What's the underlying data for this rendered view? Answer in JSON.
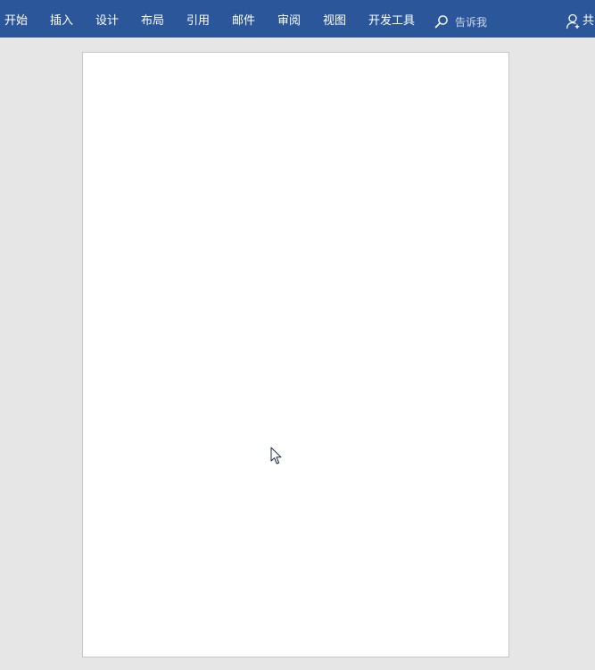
{
  "ribbon": {
    "tabs": [
      {
        "label": "开始"
      },
      {
        "label": "插入"
      },
      {
        "label": "设计"
      },
      {
        "label": "布局"
      },
      {
        "label": "引用"
      },
      {
        "label": "邮件"
      },
      {
        "label": "审阅"
      },
      {
        "label": "视图"
      },
      {
        "label": "开发工具"
      }
    ],
    "tell_me": {
      "label": "告诉我",
      "icon": "search-icon"
    },
    "share": {
      "label": "共",
      "icon": "user-icon"
    },
    "colors": {
      "background": "#2b579a",
      "text": "#ffffff"
    }
  },
  "document": {
    "background": "#e6e6e6",
    "page_color": "#ffffff"
  },
  "cursor": {
    "icon": "mouse-pointer-icon"
  }
}
